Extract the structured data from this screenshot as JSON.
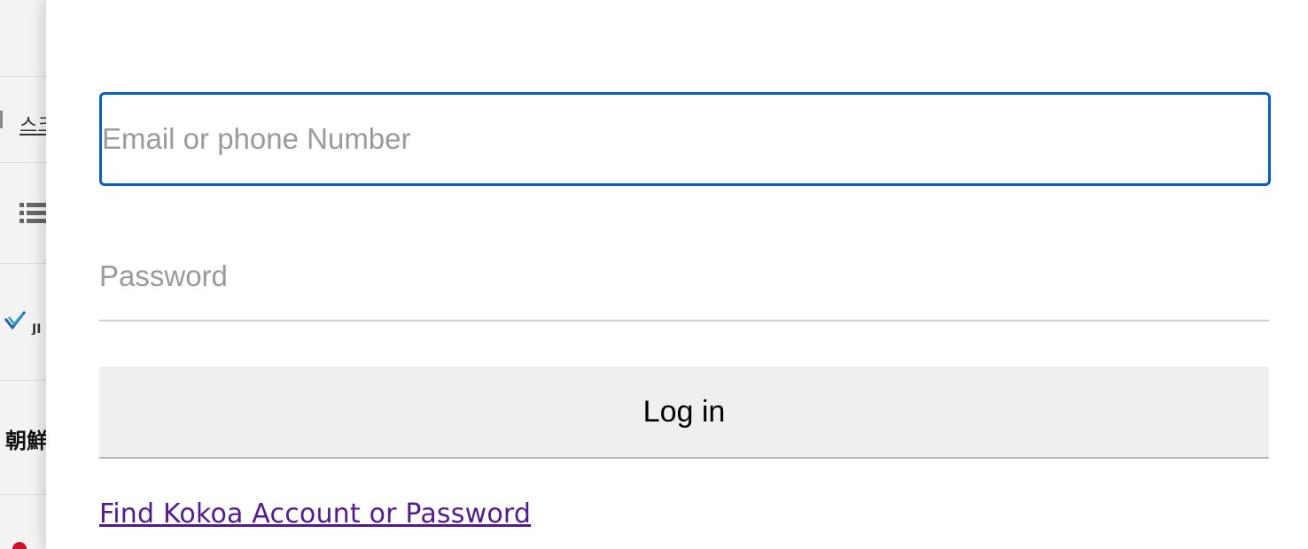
{
  "background_page": {
    "korean_fragment": "스크",
    "japanese_fragment": "朝鮮",
    "list_icon": "list-icon",
    "logo": "site-logo",
    "logo_text": "JI"
  },
  "login_form": {
    "email_placeholder": "Email or phone Number",
    "email_value": "",
    "password_placeholder": "Password",
    "password_value": "",
    "login_label": "Log in",
    "find_account_link": "Find Kokoa Account or Password"
  },
  "colors": {
    "focus_border": "#0a5fc4",
    "link_visited": "#551a8b",
    "button_bg": "#efefef"
  }
}
